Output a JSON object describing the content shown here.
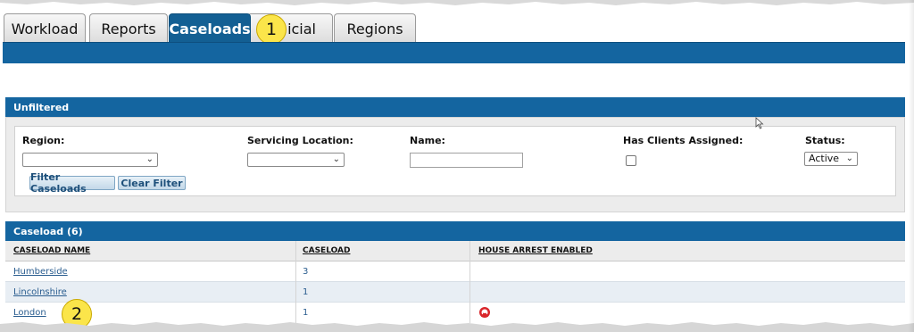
{
  "tabs": [
    {
      "label": "Workload",
      "active": false
    },
    {
      "label": "Reports",
      "active": false
    },
    {
      "label": "Caseloads",
      "active": true
    },
    {
      "label": "Judicial",
      "active": false
    },
    {
      "label": "Regions",
      "active": false
    }
  ],
  "tab_partial_visible": "icial",
  "filter_panel": {
    "title": "Unfiltered",
    "region_label": "Region:",
    "region_value": "",
    "servicing_label": "Servicing Location:",
    "servicing_value": "",
    "name_label": "Name:",
    "name_value": "",
    "clients_label": "Has Clients Assigned:",
    "clients_checked": false,
    "status_label": "Status:",
    "status_value": "Active",
    "filter_button": "Filter Caseloads",
    "clear_button": "Clear Filter"
  },
  "caseload_panel": {
    "title": "Caseload (6)",
    "columns": [
      "CASELOAD NAME",
      "CASELOAD",
      "HOUSE ARREST ENABLED"
    ],
    "rows": [
      {
        "name": "Humberside",
        "caseload": "3",
        "house_arrest": false
      },
      {
        "name": "Lincolnshire",
        "caseload": "1",
        "house_arrest": false
      },
      {
        "name": "London",
        "caseload": "1",
        "house_arrest": true
      }
    ]
  },
  "callouts": [
    "1",
    "2"
  ],
  "colors": {
    "header_blue": "#1465a0",
    "callout_yellow": "#fbe54a",
    "link_blue": "#2a5d8f"
  },
  "icons": {
    "house_arrest": "house-arrest-icon",
    "cursor": "mouse-cursor-icon",
    "dropdown": "chevron-down-icon"
  }
}
